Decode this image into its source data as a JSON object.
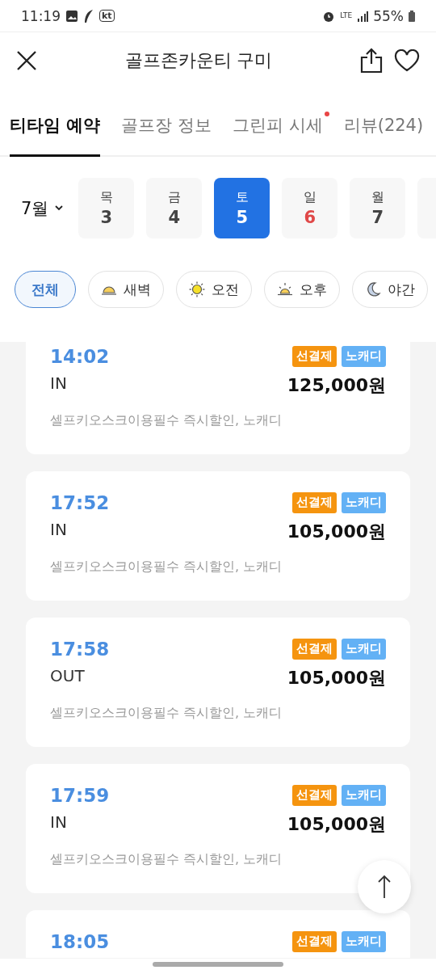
{
  "status_bar": {
    "time": "11:19",
    "carrier": "kt",
    "network": "LTE",
    "battery": "55%"
  },
  "header": {
    "title": "골프존카운티 구미"
  },
  "tabs": [
    {
      "label": "티타임 예약",
      "selected": true,
      "dot": false
    },
    {
      "label": "골프장 정보",
      "selected": false,
      "dot": false
    },
    {
      "label": "그린피 시세",
      "selected": false,
      "dot": true
    },
    {
      "label": "리뷰(224)",
      "selected": false,
      "dot": false
    }
  ],
  "month": "7월",
  "dates": [
    {
      "weekday": "목",
      "day": "3",
      "selected": false,
      "holiday": false
    },
    {
      "weekday": "금",
      "day": "4",
      "selected": false,
      "holiday": false
    },
    {
      "weekday": "토",
      "day": "5",
      "selected": true,
      "holiday": false
    },
    {
      "weekday": "일",
      "day": "6",
      "selected": false,
      "holiday": true
    },
    {
      "weekday": "월",
      "day": "7",
      "selected": false,
      "holiday": false
    }
  ],
  "filters": [
    {
      "label": "전체",
      "selected": true
    },
    {
      "label": "새벽",
      "selected": false,
      "kind": "dawn"
    },
    {
      "label": "오전",
      "selected": false,
      "kind": "morning"
    },
    {
      "label": "오후",
      "selected": false,
      "kind": "afternoon"
    },
    {
      "label": "야간",
      "selected": false,
      "kind": "night"
    }
  ],
  "teetimes": [
    {
      "time": "14:02",
      "course": "IN",
      "price": "125,000원",
      "note": "셀프키오스크이용필수 즉시할인, 노캐디",
      "tags": [
        {
          "label": "선결제",
          "color": "#f5940f"
        },
        {
          "label": "노캐디",
          "color": "#63b1f5"
        }
      ]
    },
    {
      "time": "17:52",
      "course": "IN",
      "price": "105,000원",
      "note": "셀프키오스크이용필수 즉시할인, 노캐디",
      "tags": [
        {
          "label": "선결제",
          "color": "#f5940f"
        },
        {
          "label": "노캐디",
          "color": "#63b1f5"
        }
      ]
    },
    {
      "time": "17:58",
      "course": "OUT",
      "price": "105,000원",
      "note": "셀프키오스크이용필수 즉시할인, 노캐디",
      "tags": [
        {
          "label": "선결제",
          "color": "#f5940f"
        },
        {
          "label": "노캐디",
          "color": "#63b1f5"
        }
      ]
    },
    {
      "time": "17:59",
      "course": "IN",
      "price": "105,000원",
      "note": "셀프키오스크이용필수 즉시할인, 노캐디",
      "tags": [
        {
          "label": "선결제",
          "color": "#f5940f"
        },
        {
          "label": "노캐디",
          "color": "#63b1f5"
        }
      ]
    },
    {
      "time": "18:05",
      "tags": [
        {
          "label": "선결제",
          "color": "#f5940f"
        },
        {
          "label": "노캐디",
          "color": "#63b1f5"
        }
      ]
    }
  ]
}
